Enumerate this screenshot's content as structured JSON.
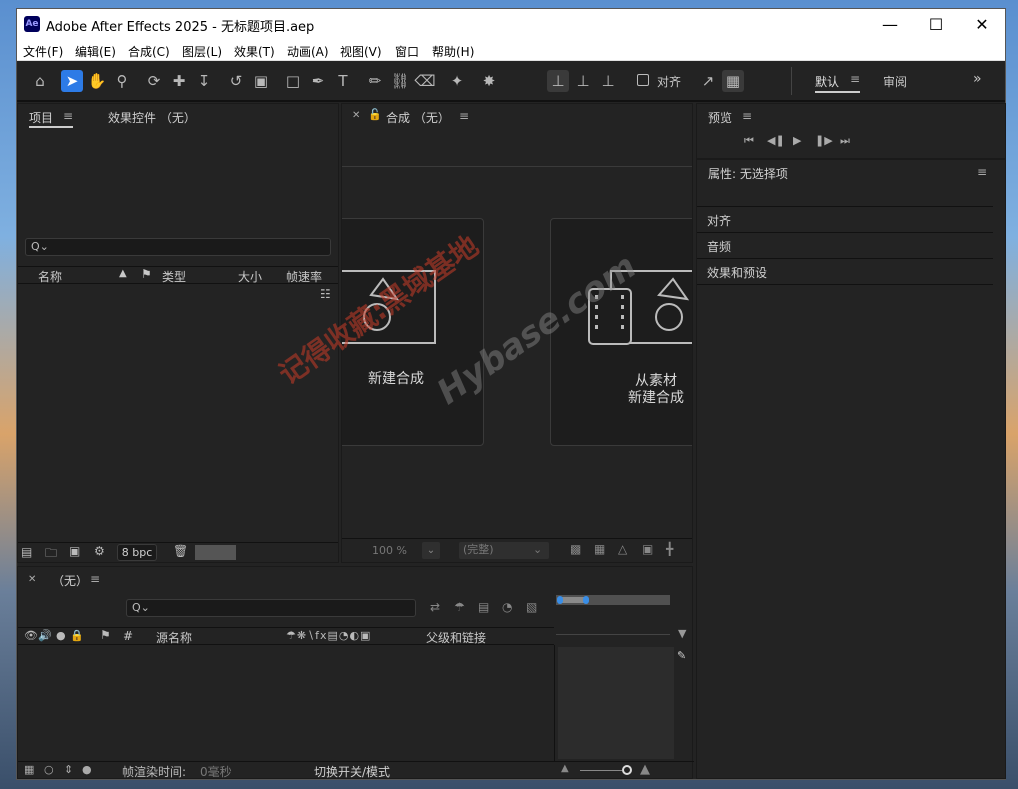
{
  "window": {
    "title": "Adobe After Effects 2025 - 无标题项目.aep",
    "logo": "Ae",
    "controls": [
      "minimize-icon",
      "maximize-icon",
      "close-icon"
    ]
  },
  "menu": [
    "文件(F)",
    "编辑(E)",
    "合成(C)",
    "图层(L)",
    "效果(T)",
    "动画(A)",
    "视图(V)",
    "窗口",
    "帮助(H)"
  ],
  "toolbar": {
    "snap_label": "对齐",
    "workspaces": [
      "默认",
      "审阅"
    ],
    "more": "»"
  },
  "project_panel": {
    "tabs": [
      "项目",
      "效果控件 （无）"
    ],
    "search_placeholder": "Q⌄",
    "columns": [
      "名称",
      "类型",
      "大小",
      "帧速率"
    ],
    "footer": {
      "bpc": "8 bpc"
    }
  },
  "comp_panel": {
    "tab": "合成 （无）",
    "cards": [
      "新建合成",
      "从素材\n新建合成"
    ],
    "zoom": "100 %",
    "quality": "(完整)"
  },
  "preview_panel": {
    "title": "预览"
  },
  "properties_panel": {
    "title": "属性: 无选择项",
    "items": [
      "对齐",
      "音频",
      "效果和预设"
    ]
  },
  "timeline": {
    "tab": "（无）",
    "columns": [
      "源名称",
      "父级和链接"
    ],
    "hash": "#",
    "footer": {
      "render_time_label": "帧渲染时间:",
      "render_time_value": "0毫秒",
      "toggle_label": "切换开关/模式"
    }
  },
  "watermark": {
    "text1": "记得收藏:黑域基地",
    "text2": "Hybase.com"
  },
  "colors": {
    "accent": "#2d7be6",
    "panel_bg": "#232323",
    "watermark": "#c83c28"
  }
}
